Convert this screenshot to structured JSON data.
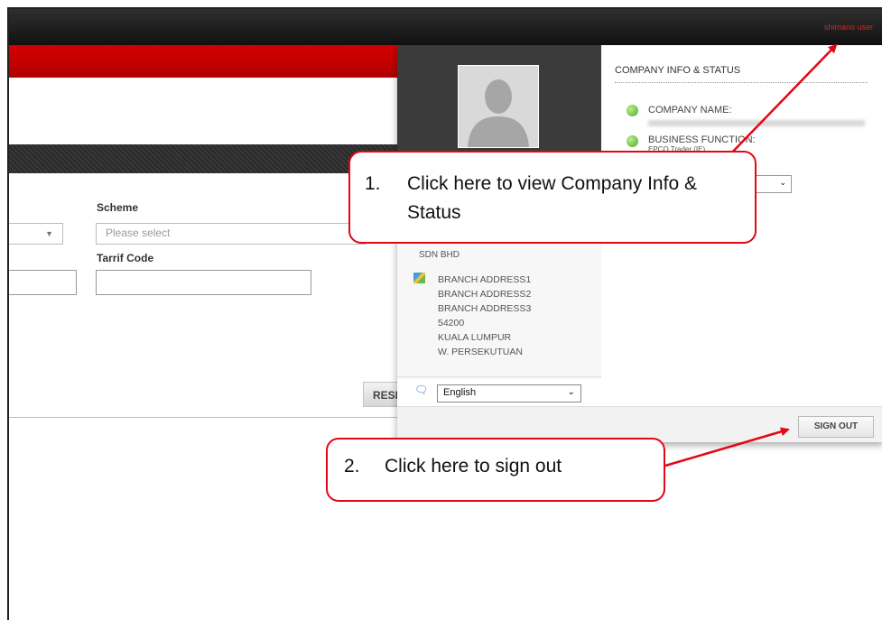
{
  "header": {
    "user_link": "shimano user"
  },
  "form": {
    "scheme_label": "Scheme",
    "scheme_placeholder": "Please select",
    "tariff_label": "Tarrif Code",
    "reset_label": "RESET"
  },
  "panel": {
    "info_heading": "COMPANY INFO & STATUS",
    "company_name_label": "COMPANY NAME:",
    "business_function_label": "BUSINESS FUNCTION:",
    "business_function_value": "EPCO Trader (IE)",
    "company_name_tail": "SDN BHD",
    "address_lines": [
      "BRANCH ADDRESS1",
      "BRANCH ADDRESS2",
      "BRANCH ADDRESS3",
      "54200",
      "KUALA LUMPUR",
      "W. PERSEKUTUAN"
    ],
    "language_value": "English",
    "sign_out_label": "SIGN OUT"
  },
  "callouts": {
    "c1_number": "1.",
    "c1_text": "Click here to view Company Info & Status",
    "c2_number": "2.",
    "c2_text": "Click here to sign out"
  },
  "colors": {
    "accent_red": "#d40000",
    "callout_red": "#e30613",
    "status_green": "#5cb935"
  }
}
